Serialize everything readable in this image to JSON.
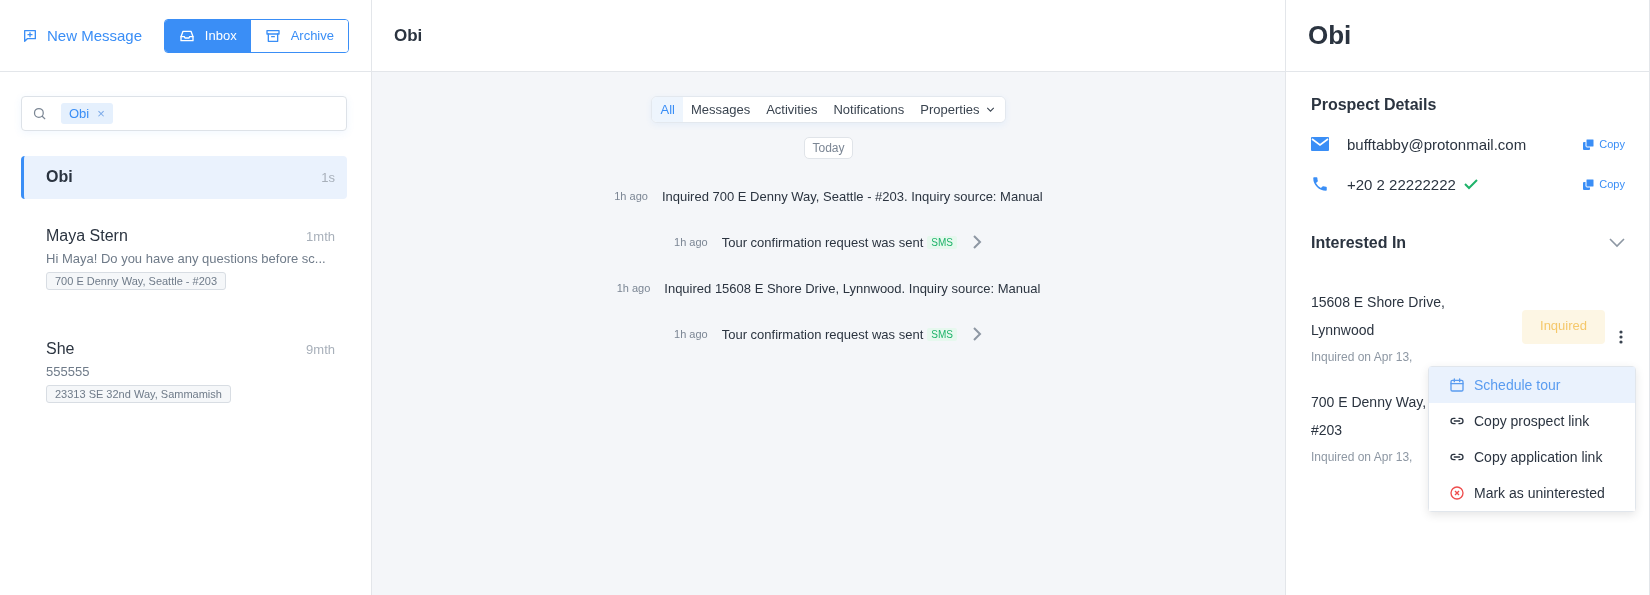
{
  "sidebar": {
    "new_message": "New Message",
    "toggle": [
      {
        "label": "Inbox",
        "selected": true
      },
      {
        "label": "Archive",
        "selected": false
      }
    ],
    "search": {
      "chips": [
        "Obi"
      ],
      "chip_remove": "×"
    },
    "conversations": [
      {
        "name": "Obi",
        "time": "1s",
        "selected": true
      },
      {
        "name": "Maya Stern",
        "time": "1mth",
        "selected": false,
        "preview": "Hi Maya! Do you have any questions before sc...",
        "tag": "700 E Denny Way, Seattle - #203"
      },
      {
        "name": "She",
        "time": "9mth",
        "selected": false,
        "preview": "555555",
        "tag": "23313 SE 32nd Way, Sammamish"
      }
    ]
  },
  "conversation": {
    "title": "Obi",
    "filters": [
      {
        "label": "All",
        "selected": true
      },
      {
        "label": "Messages",
        "selected": false
      },
      {
        "label": "Activities",
        "selected": false
      },
      {
        "label": "Notifications",
        "selected": false
      },
      {
        "label": "Properties",
        "selected": false,
        "dropdown": true
      }
    ],
    "date_divider": "Today",
    "events": [
      {
        "kind": "activity",
        "time": "1h ago",
        "text": "Inquired 700 E Denny Way, Seattle - #203. Inquiry source: Manual"
      },
      {
        "kind": "notification",
        "time": "1h ago",
        "text": "Tour confirmation request was sent",
        "badge": "SMS"
      },
      {
        "kind": "activity",
        "time": "1h ago",
        "text": "Inquired 15608 E Shore Drive, Lynnwood. Inquiry source: Manual"
      },
      {
        "kind": "notification",
        "time": "1h ago",
        "text": "Tour confirmation request was sent",
        "badge": "SMS"
      }
    ]
  },
  "details": {
    "title": "Obi",
    "section_title": "Prospect Details",
    "contacts": [
      {
        "kind": "email",
        "value": "bufftabby@protonmail.com",
        "verified": false,
        "action": "Copy"
      },
      {
        "kind": "phone",
        "value": "+20 2 22222222",
        "verified": true,
        "action": "Copy"
      }
    ],
    "interested_title": "Interested In",
    "interested_expanded": true,
    "properties": [
      {
        "lines": [
          "15608 E Shore Drive,",
          "Lynnwood"
        ],
        "status": "Inquired",
        "date": "Inquired on Apr 13,"
      },
      {
        "lines": [
          "700 E Denny Way,",
          "#203"
        ],
        "date": "Inquired on Apr 13,"
      }
    ],
    "menu": [
      {
        "kind": "calendar",
        "label": "Schedule tour",
        "selected": true
      },
      {
        "kind": "link",
        "label": "Copy prospect link",
        "selected": false
      },
      {
        "kind": "link",
        "label": "Copy application link",
        "selected": false
      },
      {
        "kind": "remove",
        "label": "Mark as uninterested",
        "selected": false
      }
    ]
  }
}
